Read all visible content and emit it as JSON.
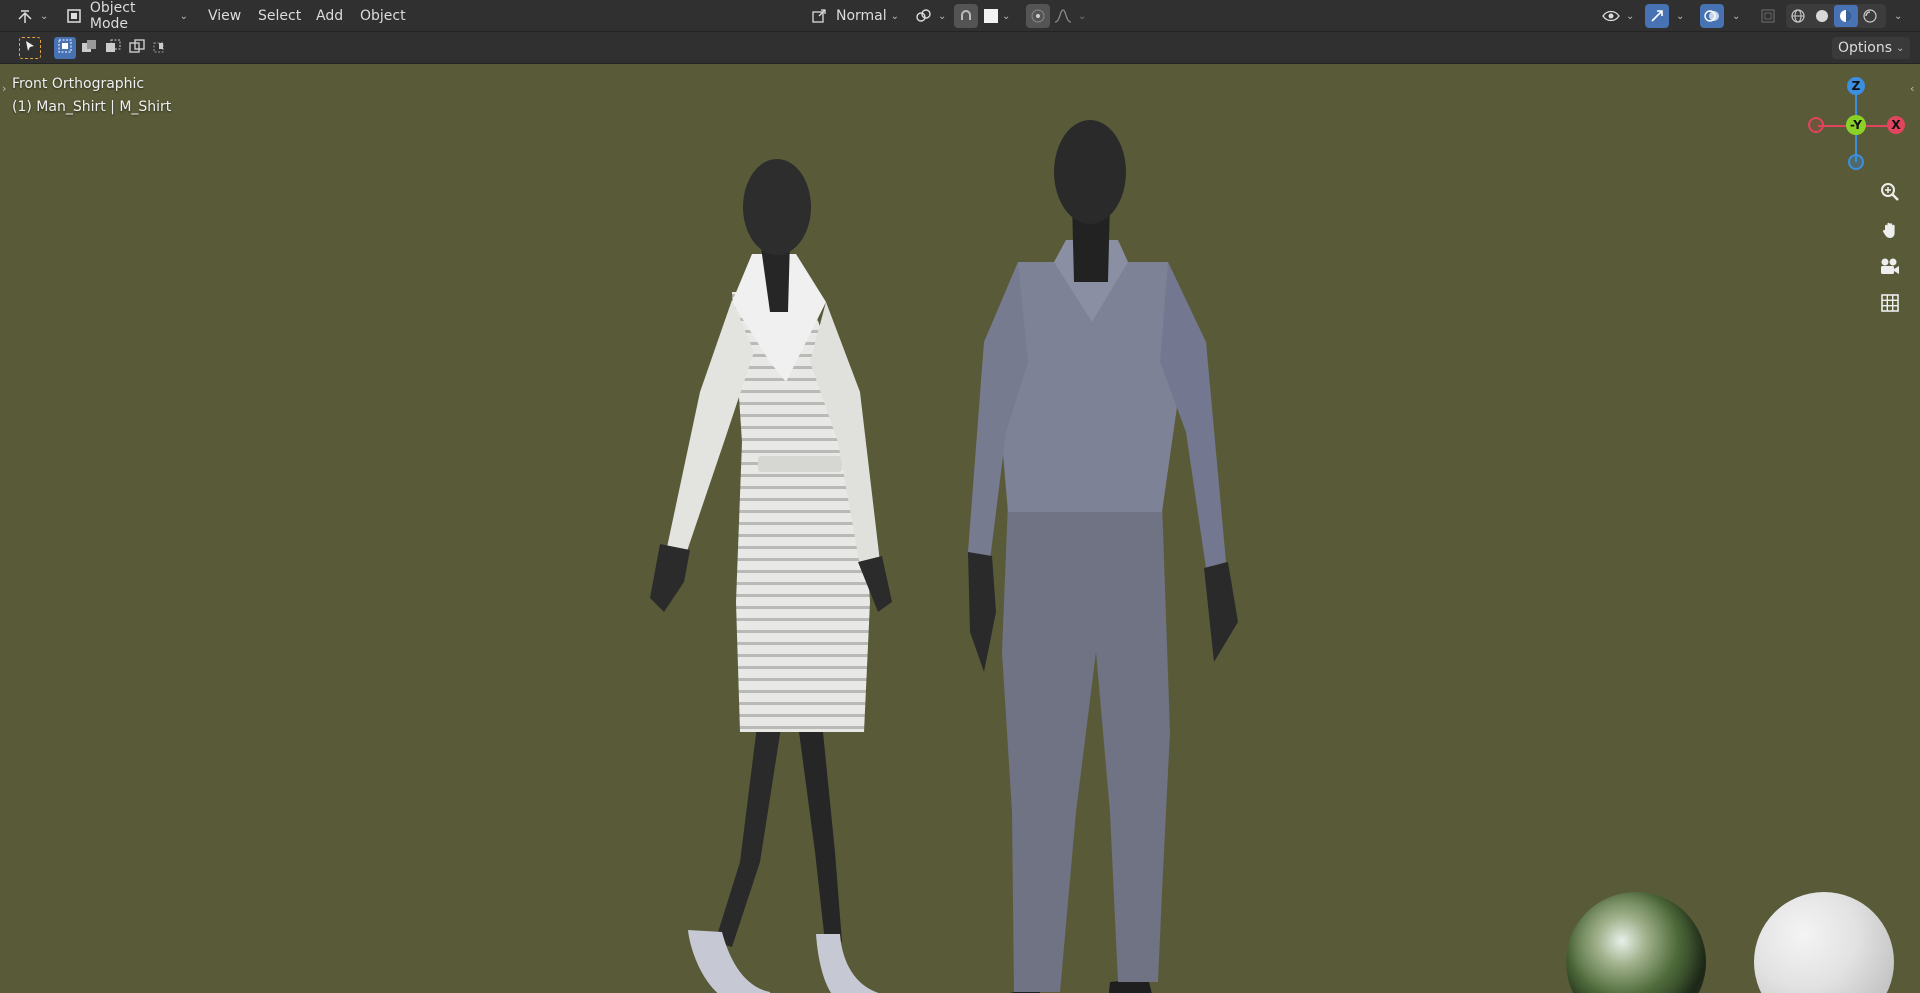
{
  "header": {
    "mode_label": "Object Mode",
    "menus": [
      "View",
      "Select",
      "Add",
      "Object"
    ],
    "transform_orientation": "Normal",
    "options_label": "Options"
  },
  "viewport": {
    "view_name": "Front Orthographic",
    "active_object": "(1) Man_Shirt | M_Shirt",
    "gizmo": {
      "z_label": "Z",
      "neg_y_label": "-Y",
      "x_label": "X"
    }
  },
  "colors": {
    "viewport_bg": "#595b38",
    "header_bg": "#303030",
    "accent_blue": "#4772b3",
    "gizmo_x": "#e0455d",
    "gizmo_y": "#8ad228",
    "gizmo_z": "#3c8ee0"
  },
  "icons": {
    "editor_type": "editor-type-icon",
    "object_mode": "object-mode-icon",
    "pivot": "pivot-icon",
    "snap": "snap-icon",
    "proportional": "proportional-edit-icon",
    "zoom": "zoom-icon",
    "pan": "hand-icon",
    "camera": "camera-icon",
    "grid": "grid-icon"
  }
}
